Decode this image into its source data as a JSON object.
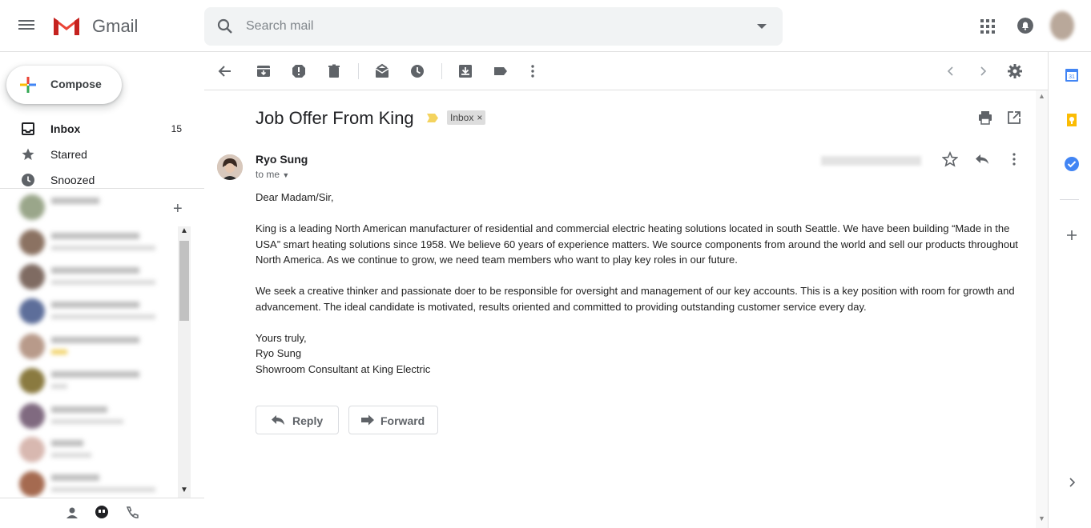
{
  "header": {
    "app_name": "Gmail",
    "search_placeholder": "Search mail"
  },
  "sidebar": {
    "compose_label": "Compose",
    "items": [
      {
        "label": "Inbox",
        "count": "15",
        "icon": "inbox-icon"
      },
      {
        "label": "Starred",
        "count": "",
        "icon": "star-icon"
      },
      {
        "label": "Snoozed",
        "count": "",
        "icon": "clock-icon"
      }
    ]
  },
  "toolbar": {
    "icons": [
      "back-arrow-icon",
      "archive-icon",
      "report-spam-icon",
      "delete-icon",
      "mark-unread-icon",
      "snooze-icon",
      "move-to-icon",
      "label-icon",
      "more-icon",
      "older-icon",
      "newer-icon",
      "settings-icon"
    ]
  },
  "email": {
    "subject": "Job Offer From King",
    "label_chip": "Inbox",
    "sender_name": "Ryo Sung",
    "recipient": "to me",
    "greeting": "Dear Madam/Sir,",
    "paragraph1": "King is a leading North American manufacturer of residential and commercial electric heating solutions located in south Seattle. We have been building “Made in the USA” smart heating solutions since 1958. We believe 60 years of experience matters. We source components from around the world and sell our products throughout North America. As we continue to grow, we need team members who want to play key roles in our future.",
    "paragraph2": "We seek a creative thinker and passionate doer to be responsible for oversight and management of our key accounts. This is a key position with room for growth and advancement. The ideal candidate is motivated, results oriented and committed to providing outstanding customer service every day.",
    "closing": "Yours truly,",
    "signature_name": "Ryo Sung",
    "signature_title": "Showroom Consultant at King Electric",
    "reply_label": "Reply",
    "forward_label": "Forward"
  },
  "colors": {
    "accent_blue": "#4285f4",
    "red": "#ea4335",
    "yellow": "#fbbc04",
    "green": "#34a853",
    "importance_marker": "#f4d35e"
  }
}
